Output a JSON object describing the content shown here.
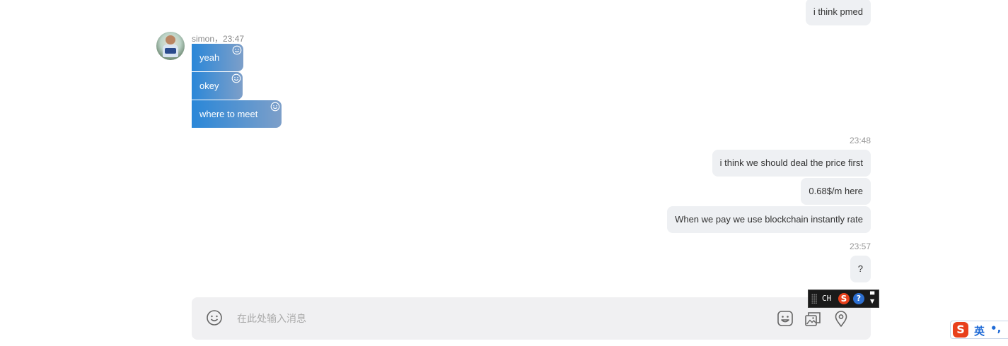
{
  "incoming": {
    "sender_time": "simon，23:47",
    "messages": [
      "yeah",
      "okey",
      "where to meet"
    ]
  },
  "outgoing_top": "i think pmed",
  "group1": {
    "time": "23:48",
    "messages": [
      "i think we should deal the price first",
      "0.68$/m here",
      "When we pay we use blockchain instantly rate"
    ]
  },
  "group2": {
    "time": "23:57",
    "messages": [
      "?"
    ]
  },
  "composer": {
    "placeholder": "在此处输入消息",
    "value": ""
  },
  "ime_toolbar": {
    "mode": "CH",
    "help": "?"
  },
  "ime_status": {
    "logo": "S",
    "mode": "英",
    "punct": "•,"
  },
  "icons": {
    "reaction": "smile-icon",
    "emoji": "smile-icon",
    "sticker": "sticker-icon",
    "image": "image-icon",
    "location": "location-pin-icon"
  },
  "colors": {
    "incoming_start": "#2a87d8",
    "incoming_end": "#7d9fc9",
    "outgoing_bg": "#eef0f3",
    "composer_bg": "#f0f0f2"
  }
}
